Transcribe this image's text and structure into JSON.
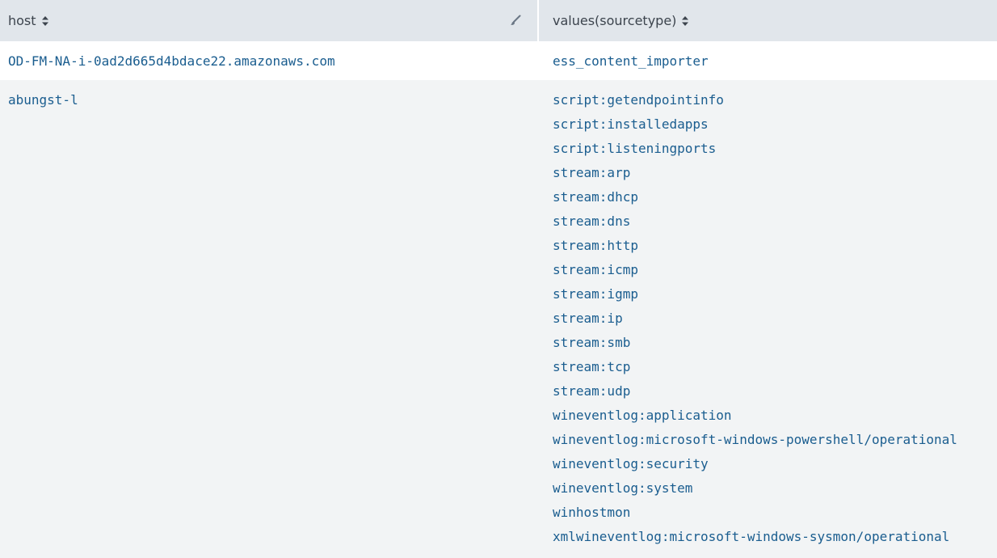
{
  "header": {
    "host_label": "host",
    "values_label": "values(sourcetype)",
    "sort_icon": "sort-updown-icon",
    "format_icon": "brush-icon"
  },
  "rows": [
    {
      "host": "OD-FM-NA-i-0ad2d665d4bdace22.amazonaws.com",
      "values": [
        "ess_content_importer"
      ]
    },
    {
      "host": "abungst-l",
      "values": [
        "script:getendpointinfo",
        "script:installedapps",
        "script:listeningports",
        "stream:arp",
        "stream:dhcp",
        "stream:dns",
        "stream:http",
        "stream:icmp",
        "stream:igmp",
        "stream:ip",
        "stream:smb",
        "stream:tcp",
        "stream:udp",
        "wineventlog:application",
        "wineventlog:microsoft-windows-powershell/operational",
        "wineventlog:security",
        "wineventlog:system",
        "winhostmon",
        "xmlwineventlog:microsoft-windows-sysmon/operational"
      ]
    }
  ],
  "colors": {
    "header_bg": "#e1e6eb",
    "link": "#1a5d8f",
    "row_alt_bg": "#f2f4f5"
  }
}
